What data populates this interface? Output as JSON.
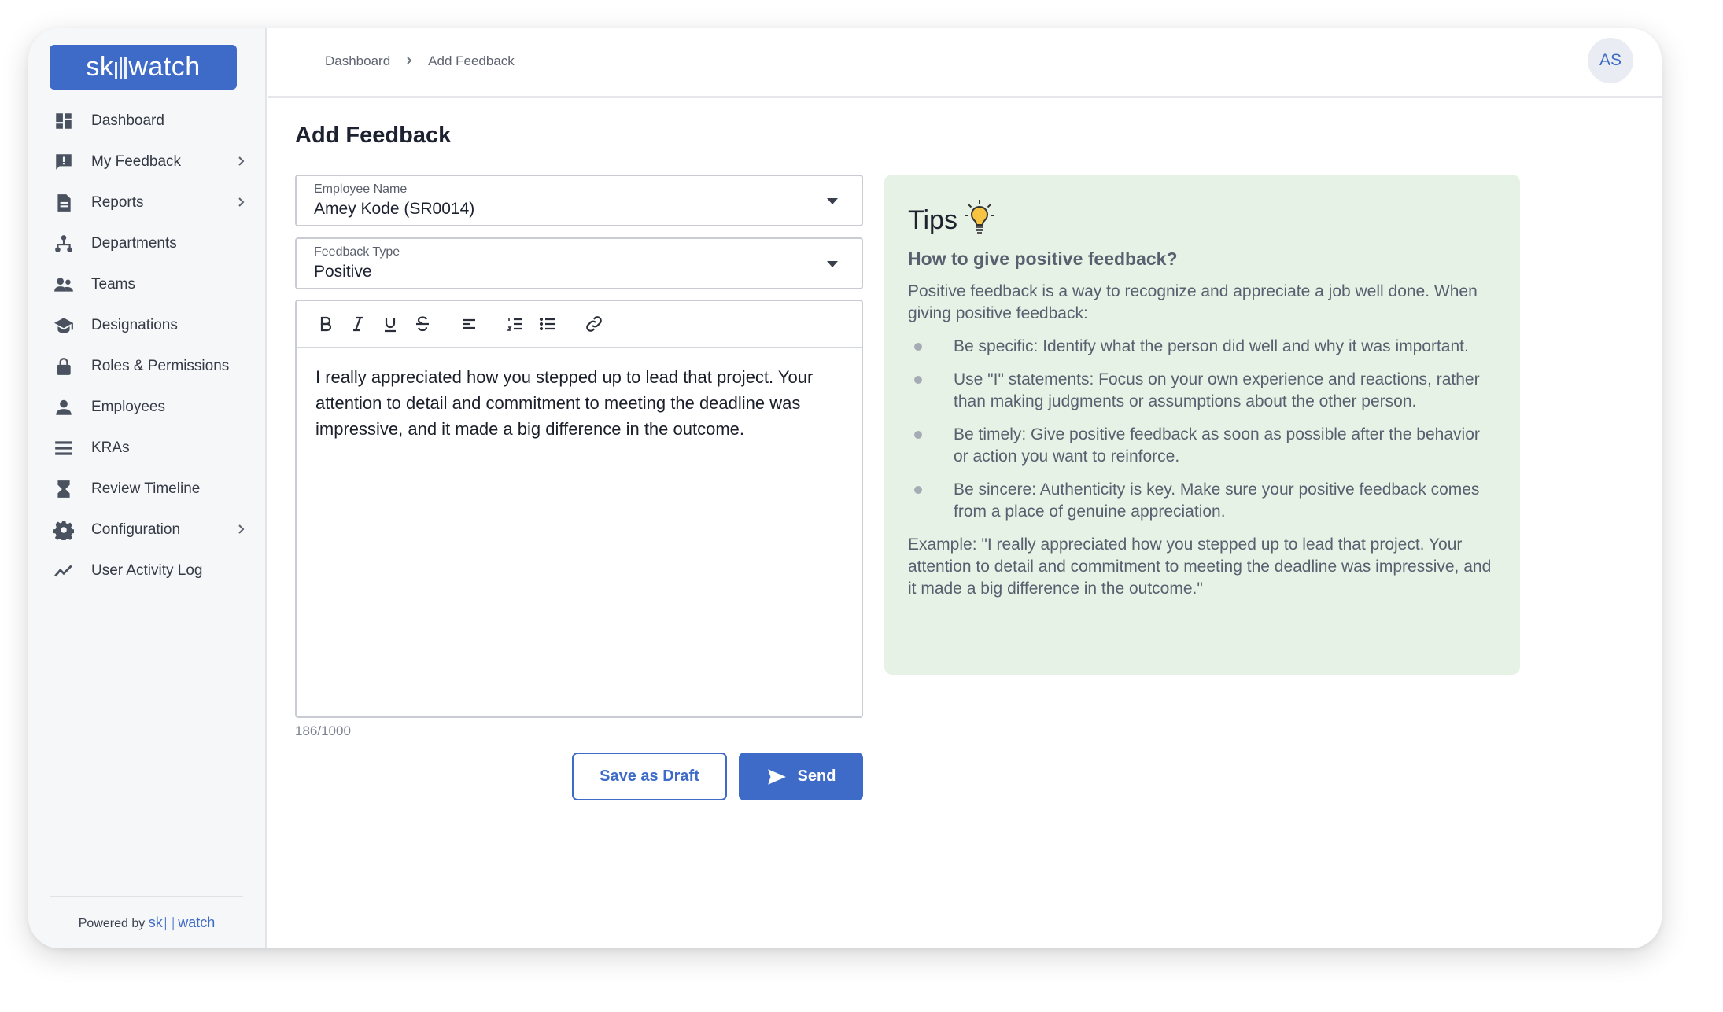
{
  "app": {
    "logo_text": "skillwatch",
    "logo_left": "sk",
    "logo_right": "watch"
  },
  "sidebar": {
    "items": [
      {
        "label": "Dashboard",
        "icon": "dashboard-icon",
        "has_chevron": false
      },
      {
        "label": "My Feedback",
        "icon": "feedback-icon",
        "has_chevron": true
      },
      {
        "label": "Reports",
        "icon": "report-icon",
        "has_chevron": true
      },
      {
        "label": "Departments",
        "icon": "org-chart-icon",
        "has_chevron": false
      },
      {
        "label": "Teams",
        "icon": "people-icon",
        "has_chevron": false
      },
      {
        "label": "Designations",
        "icon": "graduation-cap-icon",
        "has_chevron": false
      },
      {
        "label": "Roles & Permissions",
        "icon": "lock-icon",
        "has_chevron": false
      },
      {
        "label": "Employees",
        "icon": "person-icon",
        "has_chevron": false
      },
      {
        "label": "KRAs",
        "icon": "list-icon",
        "has_chevron": false
      },
      {
        "label": "Review Timeline",
        "icon": "hourglass-icon",
        "has_chevron": false
      },
      {
        "label": "Configuration",
        "icon": "gear-icon",
        "has_chevron": true
      },
      {
        "label": "User Activity Log",
        "icon": "trend-line-icon",
        "has_chevron": false
      }
    ],
    "footer": {
      "powered_by": "Powered by",
      "brand_left": "sk",
      "brand_right": "watch"
    }
  },
  "header": {
    "breadcrumb": [
      "Dashboard",
      "Add Feedback"
    ],
    "avatar_initials": "AS"
  },
  "main": {
    "title": "Add Feedback",
    "employee_select": {
      "label": "Employee Name",
      "value": "Amey Kode (SR0014)"
    },
    "type_select": {
      "label": "Feedback Type",
      "value": "Positive"
    },
    "editor": {
      "text": "I really appreciated how you stepped up to lead that project. Your attention to detail and commitment to meeting the deadline was impressive, and it made a big difference in the outcome.",
      "counter": "186/1000"
    },
    "buttons": {
      "draft": "Save as Draft",
      "send": "Send"
    }
  },
  "tips": {
    "title": "Tips",
    "subtitle": "How to give positive feedback?",
    "intro": "Positive feedback is a way to recognize and appreciate a job well done. When giving positive feedback:",
    "items": [
      "Be specific: Identify what the person did well and why it was important.",
      "Use \"I\" statements: Focus on your own experience and reactions, rather than making judgments or assumptions about the other person.",
      "Be timely: Give positive feedback as soon as possible after the behavior or action you want to reinforce.",
      "Be sincere: Authenticity is key. Make sure your positive feedback comes from a place of genuine appreciation."
    ],
    "example": "Example: \"I really appreciated how you stepped up to lead that project. Your attention to detail and commitment to meeting the deadline was impressive, and it made a big difference in the outcome.\""
  },
  "colors": {
    "brand": "#3e6bc8",
    "tips_bg": "#e7f2e6",
    "sidebar_bg": "#f6f7f8"
  }
}
